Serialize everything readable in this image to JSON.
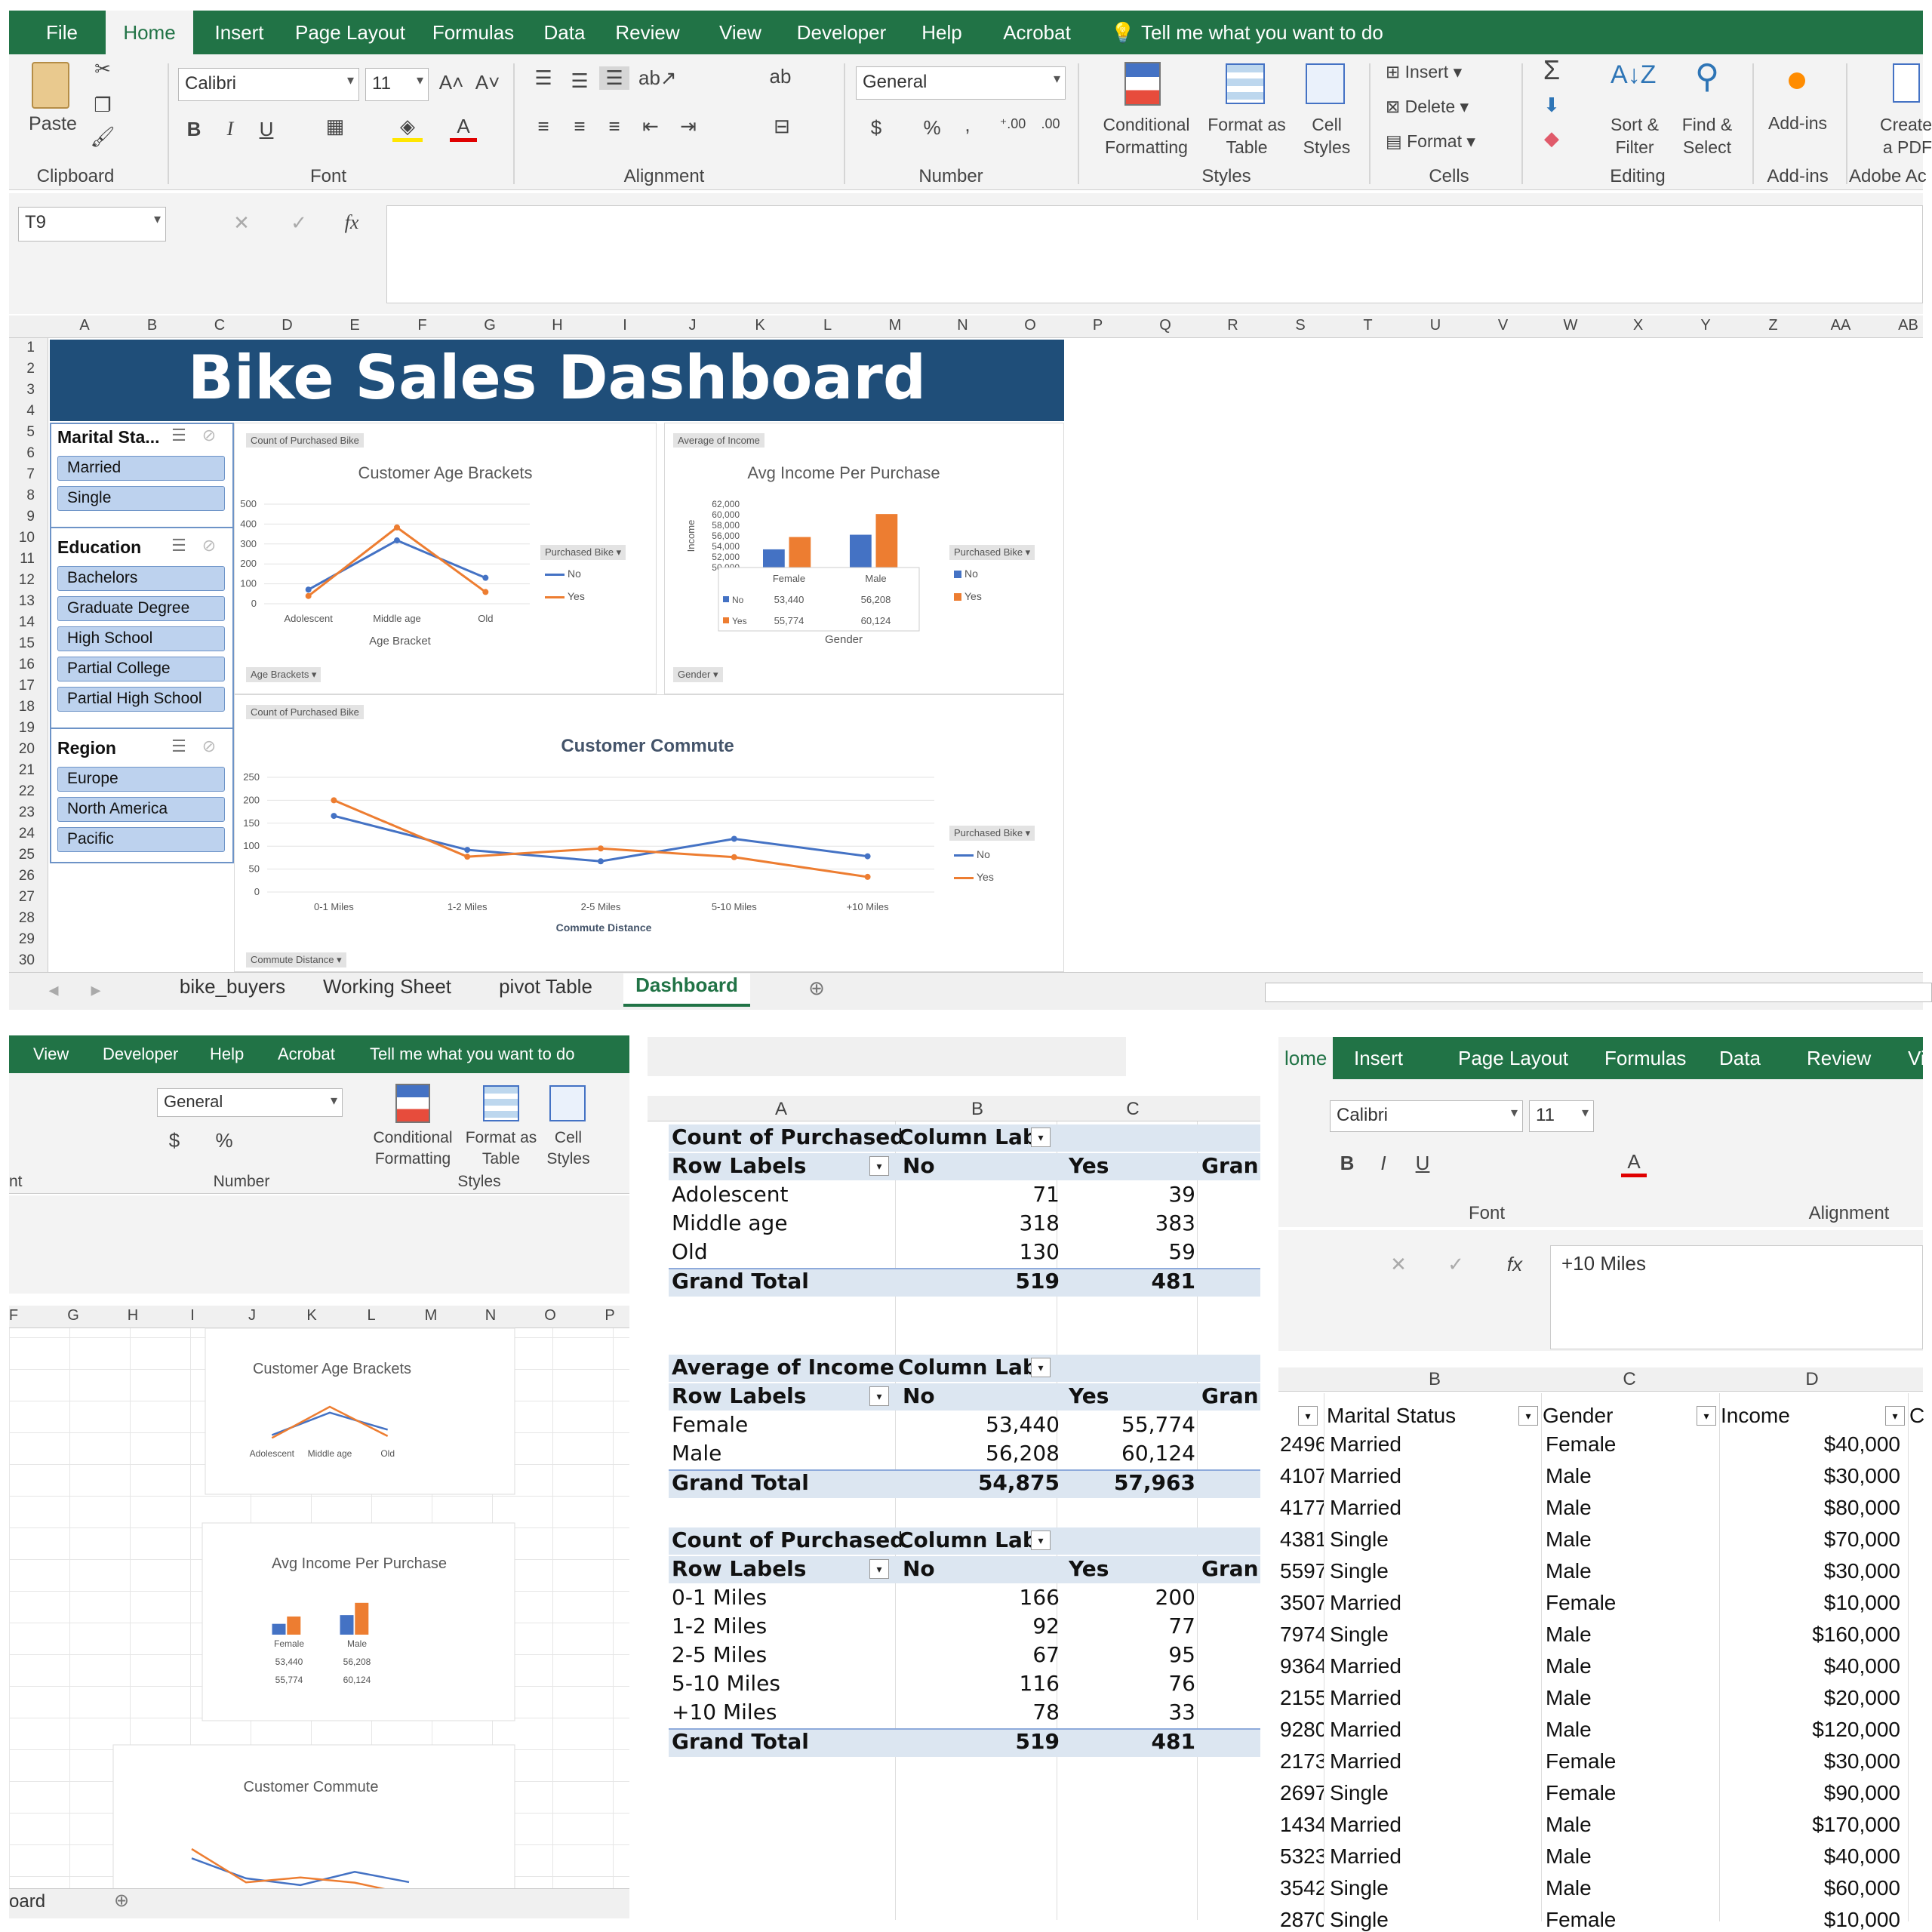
{
  "ribbon": {
    "tabs": [
      "File",
      "Home",
      "Insert",
      "Page Layout",
      "Formulas",
      "Data",
      "Review",
      "View",
      "Developer",
      "Help",
      "Acrobat"
    ],
    "tell_me": "Tell me what you want to do",
    "clipboard": {
      "paste": "Paste",
      "group": "Clipboard"
    },
    "font": {
      "name": "Calibri",
      "size": "11",
      "group": "Font",
      "bold": "B",
      "italic": "I",
      "underline": "U",
      "grow": "A˄",
      "shrink": "A˅",
      "color_letter": "A"
    },
    "alignment": {
      "group": "Alignment"
    },
    "number": {
      "format": "General",
      "group": "Number",
      "currency": "$",
      "percent": "%",
      "comma": ","
    },
    "styles": {
      "cond": "Conditional Formatting",
      "table": "Format as Table",
      "cell": "Cell Styles",
      "group": "Styles"
    },
    "cells": {
      "insert": "Insert",
      "delete": "Delete",
      "format": "Format",
      "group": "Cells"
    },
    "editing": {
      "sort": "Sort & Filter",
      "find": "Find & Select",
      "group": "Editing"
    },
    "addins": {
      "label": "Add-ins",
      "group": "Add-ins"
    },
    "adobe": {
      "label": "Create a PDF",
      "group": "Adobe Ac"
    }
  },
  "formula_bar": {
    "name_box": "T9",
    "fx": "fx",
    "value": ""
  },
  "columns": [
    "A",
    "B",
    "C",
    "D",
    "E",
    "F",
    "G",
    "H",
    "I",
    "J",
    "K",
    "L",
    "M",
    "N",
    "O",
    "P",
    "Q",
    "R",
    "S",
    "T",
    "U",
    "V",
    "W",
    "X",
    "Y",
    "Z",
    "AA",
    "AB"
  ],
  "rows": [
    "1",
    "2",
    "3",
    "4",
    "5",
    "6",
    "7",
    "8",
    "9",
    "10",
    "11",
    "12",
    "13",
    "14",
    "15",
    "16",
    "17",
    "18",
    "19",
    "20",
    "21",
    "22",
    "23",
    "24",
    "25",
    "26",
    "27",
    "28",
    "29",
    "30"
  ],
  "dashboard": {
    "title": "Bike Sales Dashboard",
    "slicers": [
      {
        "title": "Marital Sta...",
        "items": [
          "Married",
          "Single"
        ]
      },
      {
        "title": "Education",
        "items": [
          "Bachelors",
          "Graduate Degree",
          "High School",
          "Partial College",
          "Partial High School"
        ]
      },
      {
        "title": "Region",
        "items": [
          "Europe",
          "North America",
          "Pacific"
        ]
      }
    ]
  },
  "colors": {
    "excel_green": "#217346",
    "dash_blue": "#1f4e79",
    "series_no": "#4472c4",
    "series_yes": "#ed7d31"
  },
  "chart_data": [
    {
      "type": "line",
      "title": "Customer Age Brackets",
      "pivot_field": "Count of Purchased Bike",
      "filter_button": "Age Brackets",
      "categories": [
        "Adolescent",
        "Middle age",
        "Old"
      ],
      "xlabel": "Age Bracket",
      "ylim": [
        0,
        500
      ],
      "yticks": [
        "500",
        "400",
        "300",
        "200",
        "100",
        "0"
      ],
      "legend_title": "Purchased Bike",
      "series": [
        {
          "name": "No",
          "values": [
            71,
            318,
            130
          ]
        },
        {
          "name": "Yes",
          "values": [
            39,
            383,
            59
          ]
        }
      ]
    },
    {
      "type": "bar",
      "title": "Avg Income Per Purchase",
      "pivot_field": "Average of Income",
      "filter_button": "Gender",
      "categories": [
        "Female",
        "Male"
      ],
      "xlabel": "Gender",
      "ylabel": "Income",
      "ylim": [
        50000,
        62000
      ],
      "yticks": [
        "62,000",
        "60,000",
        "58,000",
        "56,000",
        "54,000",
        "52,000",
        "50,000"
      ],
      "legend_title": "Purchased Bike",
      "series": [
        {
          "name": "No",
          "values": [
            53440,
            56208
          ],
          "labels": [
            "53,440",
            "56,208"
          ]
        },
        {
          "name": "Yes",
          "values": [
            55774,
            60124
          ],
          "labels": [
            "55,774",
            "60,124"
          ]
        }
      ]
    },
    {
      "type": "line",
      "title": "Customer Commute",
      "pivot_field": "Count of Purchased Bike",
      "filter_button": "Commute Distance",
      "categories": [
        "0-1 Miles",
        "1-2 Miles",
        "2-5 Miles",
        "5-10 Miles",
        "+10 Miles"
      ],
      "xlabel": "Commute Distance",
      "ylim": [
        0,
        250
      ],
      "yticks": [
        "250",
        "200",
        "150",
        "100",
        "50",
        "0"
      ],
      "legend_title": "Purchased Bike",
      "series": [
        {
          "name": "No",
          "values": [
            166,
            92,
            67,
            116,
            78
          ]
        },
        {
          "name": "Yes",
          "values": [
            200,
            77,
            95,
            76,
            33
          ]
        }
      ]
    }
  ],
  "sheet_tabs": [
    "bike_buyers",
    "Working Sheet",
    "pivot Table",
    "Dashboard"
  ],
  "pivot": {
    "col_headers": [
      "A",
      "B",
      "C"
    ],
    "tables": [
      {
        "title": "Count of Purchased",
        "col_labels": "Column Lab",
        "row_labels": "Row Labels",
        "no": "No",
        "yes": "Yes",
        "gran": "Gran",
        "rows": [
          [
            "Adolescent",
            "71",
            "39"
          ],
          [
            "Middle age",
            "318",
            "383"
          ],
          [
            "Old",
            "130",
            "59"
          ]
        ],
        "total": [
          "Grand Total",
          "519",
          "481"
        ]
      },
      {
        "title": "Average of Income",
        "col_labels": "Column Lab",
        "row_labels": "Row Labels",
        "no": "No",
        "yes": "Yes",
        "gran": "Gran",
        "rows": [
          [
            "Female",
            "53,440",
            "55,774"
          ],
          [
            "Male",
            "56,208",
            "60,124"
          ]
        ],
        "total": [
          "Grand Total",
          "54,875",
          "57,963"
        ]
      },
      {
        "title": "Count of Purchased",
        "col_labels": "Column Lab",
        "row_labels": "Row Labels",
        "no": "No",
        "yes": "Yes",
        "gran": "Gran",
        "rows": [
          [
            "0-1 Miles",
            "166",
            "200"
          ],
          [
            "1-2 Miles",
            "92",
            "77"
          ],
          [
            "2-5 Miles",
            "67",
            "95"
          ],
          [
            "5-10 Miles",
            "116",
            "76"
          ],
          [
            "+10 Miles",
            "78",
            "33"
          ]
        ],
        "total": [
          "Grand Total",
          "519",
          "481"
        ]
      }
    ]
  },
  "data_sheet": {
    "tabs": [
      "lome",
      "Insert",
      "Page Layout",
      "Formulas",
      "Data",
      "Review",
      "Vie"
    ],
    "formula": "+10 Miles",
    "cols": [
      "B",
      "C",
      "D"
    ],
    "headers": [
      "Marital Status",
      "Gender",
      "Income",
      "C"
    ],
    "rows": [
      [
        "2496",
        "Married",
        "Female",
        "$40,000"
      ],
      [
        "4107",
        "Married",
        "Male",
        "$30,000"
      ],
      [
        "4177",
        "Married",
        "Male",
        "$80,000"
      ],
      [
        "4381",
        "Single",
        "Male",
        "$70,000"
      ],
      [
        "5597",
        "Single",
        "Male",
        "$30,000"
      ],
      [
        "3507",
        "Married",
        "Female",
        "$10,000"
      ],
      [
        "7974",
        "Single",
        "Male",
        "$160,000"
      ],
      [
        "9364",
        "Married",
        "Male",
        "$40,000"
      ],
      [
        "2155",
        "Married",
        "Male",
        "$20,000"
      ],
      [
        "9280",
        "Married",
        "Male",
        "$120,000"
      ],
      [
        "2173",
        "Married",
        "Female",
        "$30,000"
      ],
      [
        "2697",
        "Single",
        "Female",
        "$90,000"
      ],
      [
        "1434",
        "Married",
        "Male",
        "$170,000"
      ],
      [
        "5323",
        "Married",
        "Male",
        "$40,000"
      ],
      [
        "3542",
        "Single",
        "Male",
        "$60,000"
      ],
      [
        "2870",
        "Single",
        "Female",
        "$10,000"
      ]
    ]
  },
  "small_window": {
    "tabs": [
      "View",
      "Developer",
      "Help",
      "Acrobat"
    ],
    "tell_me": "Tell me what you want to do",
    "number_format": "General",
    "number_group": "Number",
    "styles_group": "Styles",
    "font_group_tail": "nt",
    "cols": [
      "F",
      "G",
      "H",
      "I",
      "J",
      "K",
      "L",
      "M",
      "N",
      "O",
      "P"
    ],
    "sheet_tail": "oard"
  }
}
